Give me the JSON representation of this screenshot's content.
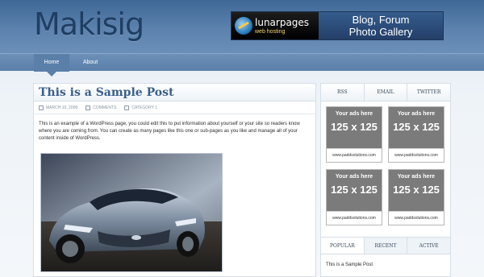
{
  "header": {
    "site_title": "Makisig",
    "banner": {
      "logo_name": "lunarpages",
      "logo_sub": "web hosting",
      "line1": "Blog, Forum",
      "line2": "Photo Gallery"
    }
  },
  "nav": {
    "items": [
      {
        "label": "Home",
        "active": true
      },
      {
        "label": "About",
        "active": false
      }
    ]
  },
  "post": {
    "title": "This is a Sample Post",
    "date": "MARCH 10, 2008",
    "comments": "COMMENTS",
    "category": "CATEGORY 1",
    "body": "This is an example of a WordPress page, you could edit this to put information about yourself or your site so readers know where you are coming from. You can create as many pages like this one or sub-pages as you like and manage all of your content inside of WordPress."
  },
  "sidebar": {
    "tabs": [
      "RSS",
      "EMAIL",
      "TWITTER"
    ],
    "ads": [
      {
        "head": "Your ads here",
        "size": "125 x 125",
        "url": "www.paddsolutions.com"
      },
      {
        "head": "Your ads here",
        "size": "125 x 125",
        "url": "www.paddsolutions.com"
      },
      {
        "head": "Your ads here",
        "size": "125 x 125",
        "url": "www.paddsolutions.com"
      },
      {
        "head": "Your ads here",
        "size": "125 x 125",
        "url": "www.paddsolutions.com"
      }
    ],
    "popular_tabs": [
      "POPULAR",
      "RECENT",
      "ACTIVE"
    ],
    "popular_item": "This is a Sample Post"
  },
  "colors": {
    "header_blue": "#4f77a4",
    "title_text": "#1f3e63",
    "post_title": "#3a5f8a",
    "ad_gray": "#7b7b7b"
  },
  "icons": [
    "calendar-icon",
    "comment-icon",
    "category-icon",
    "lunarpages-logo-icon"
  ]
}
